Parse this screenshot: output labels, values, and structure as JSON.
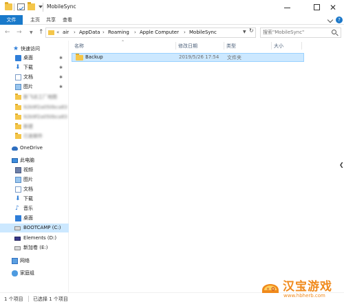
{
  "window": {
    "title": "MobileSync"
  },
  "ribbon": {
    "tabs": [
      "文件",
      "主页",
      "共享",
      "查看"
    ]
  },
  "address": {
    "chevrons": "«",
    "crumbs": [
      "air",
      "AppData",
      "Roaming",
      "Apple Computer",
      "MobileSync"
    ],
    "separator": "›"
  },
  "search": {
    "placeholder": "搜索\"MobileSync\""
  },
  "navpane": {
    "quick_access": "快速访问",
    "quick_items": [
      "桌面",
      "下载",
      "文档",
      "图片"
    ],
    "blurred_items": [
      "新飞达工厂地图",
      "92b9f2a050bca83",
      "92b9f2a050bca83",
      "新建",
      "已发邮件"
    ],
    "onedrive": "OneDrive",
    "this_pc": "此电脑",
    "pc_items": [
      "视频",
      "图片",
      "文档",
      "下载",
      "音乐",
      "桌面"
    ],
    "drives": [
      "BOOTCAMP (C:)",
      "Elements (D:)",
      "新加卷 (E:)"
    ],
    "network": "网络",
    "homegroup": "家庭组"
  },
  "columns": {
    "name": "名称",
    "date": "修改日期",
    "type": "类型",
    "size": "大小"
  },
  "files": [
    {
      "name": "Backup",
      "date": "2019/5/26 17:54",
      "type": "文件夹",
      "size": ""
    }
  ],
  "status": {
    "count": "1 个项目",
    "selected": "已选择 1 个项目"
  },
  "watermark": {
    "text": "汉宝游戏",
    "url": "www.hbherb.com"
  },
  "colors": {
    "accent": "#1979ca",
    "selection": "#cce8ff",
    "folder": "#f4c64a",
    "watermark": "#f08a1c"
  }
}
